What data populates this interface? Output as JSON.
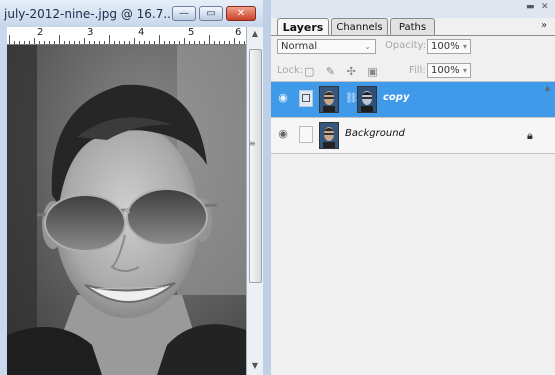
{
  "document": {
    "title": "july-2012-nine-.jpg @ 16.7...",
    "controls": {
      "minimize": "—",
      "maximize": "▭",
      "close": "✕"
    },
    "ruler_numbers": [
      "2",
      "3",
      "4",
      "5",
      "6"
    ],
    "scroll_up": "▲",
    "scroll_grip": "≡",
    "scroll_down": "▼"
  },
  "panel": {
    "top_buttons": {
      "collapse": "▬",
      "close": "✕"
    },
    "tabs": [
      "Layers",
      "Channels",
      "Paths"
    ],
    "menu": "»",
    "blend_mode": "Normal",
    "opacity_label": "Opacity:",
    "opacity_value": "100%",
    "lock_label": "Lock:",
    "lock_icons": "▢ ✎ ✣ ▣",
    "fill_label": "Fill:",
    "fill_value": "100%",
    "layers": [
      {
        "name": "copy",
        "selected": true,
        "visible_icon": "eye-icon"
      },
      {
        "name": "Background",
        "selected": false,
        "visible_icon": "eye-icon",
        "locked": true
      }
    ],
    "scroll_up": "▲"
  },
  "colors": {
    "selection": "#3f9bea",
    "window_chrome": "#c9d8ec",
    "close_button": "#c9412a"
  }
}
